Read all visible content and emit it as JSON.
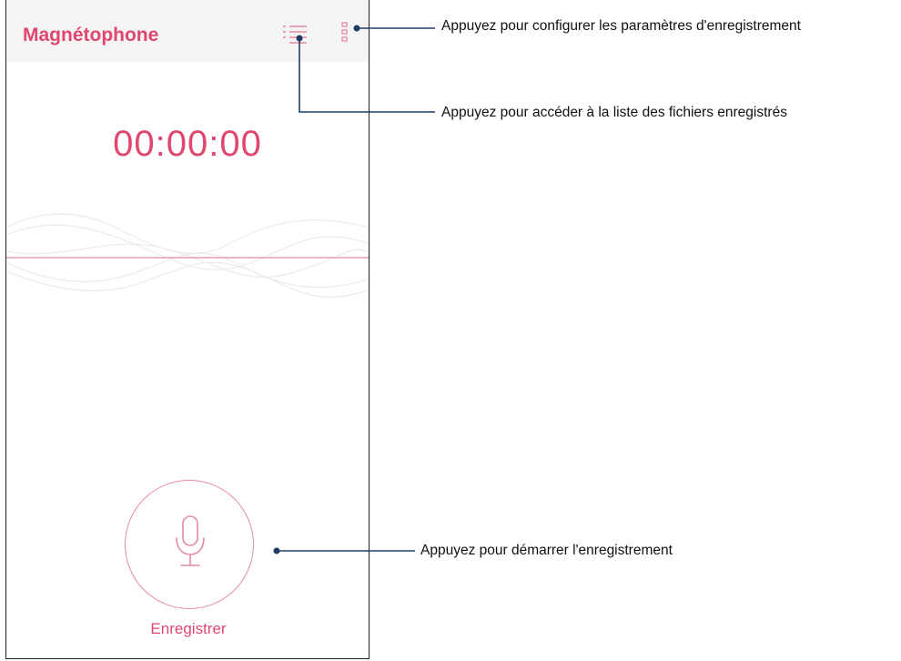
{
  "app": {
    "title": "Magnétophone",
    "accent_color": "#e0476e"
  },
  "toolbar": {
    "list_icon": "list-icon",
    "more_icon": "more-vertical-icon"
  },
  "timer": {
    "value": "00:00:00"
  },
  "record": {
    "icon": "microphone-icon",
    "label": "Enregistrer"
  },
  "annotations": {
    "settings": "Appuyez pour configurer les paramètres d'enregistrement",
    "recordings_list": "Appuyez pour accéder à la liste des fichiers enregistrés",
    "start_recording": "Appuyez pour démarrer l'enregistrement"
  }
}
